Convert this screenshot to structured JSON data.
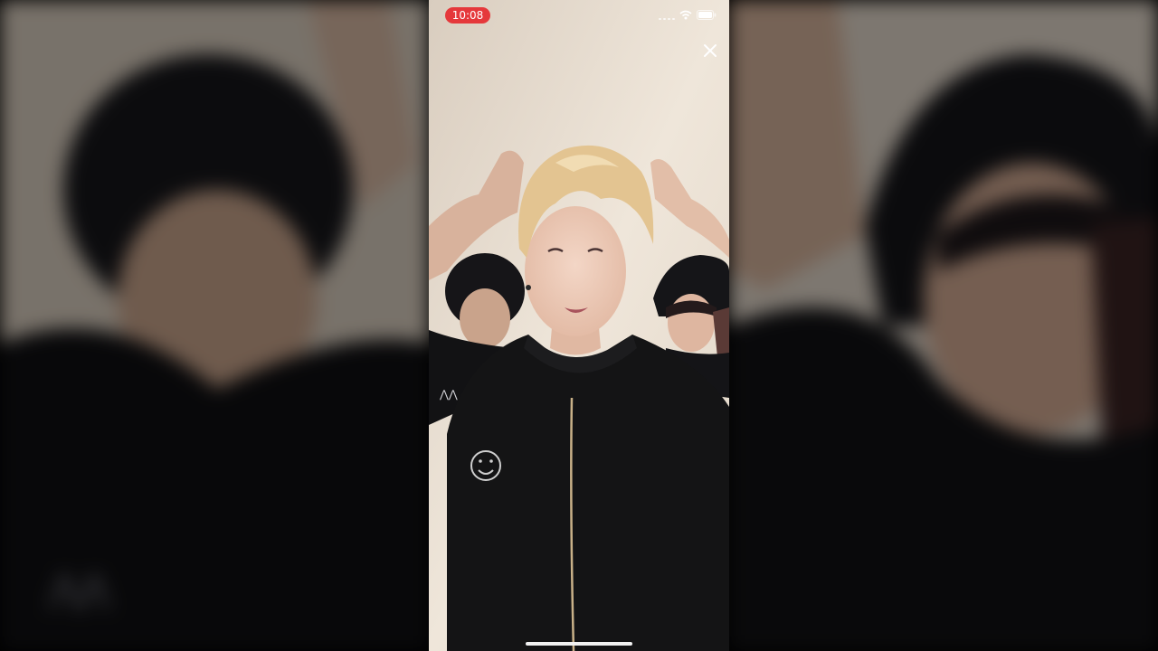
{
  "status_bar": {
    "time": "10:08"
  },
  "icons": {
    "signal": "cellular-signal-icon",
    "wifi": "wifi-icon",
    "battery": "battery-icon",
    "close": "close-icon"
  },
  "colors": {
    "time_pill": "#e5383b",
    "wall": "#e8ddd0",
    "hoodie": "#141414",
    "hair": "#e3c491"
  }
}
